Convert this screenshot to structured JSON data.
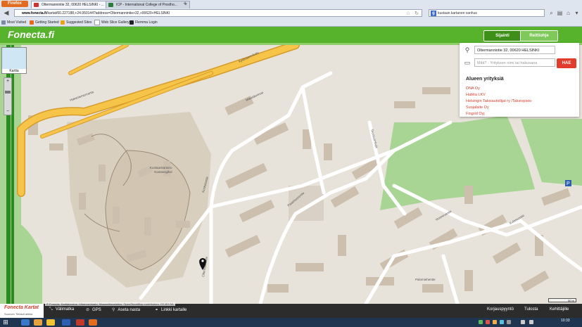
{
  "browser": {
    "menu_button": "Firefox",
    "tabs": [
      {
        "label": "Oltermannintie 32, 00620 HELSINKI - ...",
        "active": true
      },
      {
        "label": "ICP - International College of Prostho...",
        "active": false
      }
    ],
    "new_tab": "+",
    "url_site": "www.fonecta.fi",
    "url_path": "/kartat/60.227188,+24.950144?address=Oltermannintie+32,+00620+HELSINKI",
    "web_search": "kustaan kartanon vanhus",
    "bookmarks": [
      "Most Visited",
      "Getting Started",
      "Suggested Sites",
      "Web Slice Gallery",
      "Flemma Login"
    ]
  },
  "header": {
    "logo": "Fonecta.fi",
    "tabs": [
      "Sijainti",
      "Reittiohje"
    ]
  },
  "map": {
    "thumbnail_label": "Kartta",
    "zoom_in": "+",
    "zoom_out": "−",
    "labels": {
      "kustaankartano": "Kustaankartano",
      "kustaankartano2": "Gustavsgård",
      "koskelantie": "Koskelantie",
      "kyläsaarenkatu": "Kyläsaarenkatu",
      "makelanrinne": "Mäkelänrinne",
      "oltermannintie": "Oltermannintie",
      "paasivuorentie": "Paasivuorentie",
      "teerisuonkuja": "Teerisuonkuja",
      "isonnevantie": "Isonnevantie",
      "kulasuontie": "Kulasuontie",
      "palomiehentie": "Palomiehentie",
      "hakaniemenranta": "Hakaniemenranta"
    },
    "scale": "50 m"
  },
  "search_panel": {
    "address_value": "Oltermannintie 32, 00620 HELSINKI",
    "what_placeholder": "Mitä? - Yrityksen nimi tai hakusana",
    "search_button": "HAE",
    "area_title": "Alueen yrityksiä",
    "businesses": [
      "DNA Oy",
      "Habita LKV",
      "Helsingin Taksiautoilijat ry /Taksiopisto",
      "Suojalaite Oy",
      "Fingrid Oyj"
    ]
  },
  "toolbar": {
    "brand_title": "Fonecta Kartat",
    "brand_sub": "Suomen Tietävä alikka",
    "attribution": "© Fonecta, Karttakeskus, Liikennevirasto, Maanmittauslaitos, OpenStreetMap contributors, CC-BY-SA",
    "left_items": [
      {
        "label": "Välimatka",
        "icon": "ruler-icon",
        "glyph": "⤡"
      },
      {
        "label": "GPS",
        "icon": "gps-icon",
        "glyph": "⊘"
      },
      {
        "label": "Aseta nasta",
        "icon": "pin-icon",
        "glyph": "⚲"
      },
      {
        "label": "Linkki kartalle",
        "icon": "link-icon",
        "glyph": "⚭"
      }
    ],
    "right_items": [
      "Korjauspyyntö",
      "Tulosta",
      "Kehittäjille"
    ]
  },
  "taskbar": {
    "clock": "10:33"
  },
  "colors": {
    "brand_green": "#56b32b",
    "accent_red": "#e23c2c",
    "highway_yellow": "#f6c448",
    "green_park": "#a8d494",
    "building": "#cdbfae"
  }
}
